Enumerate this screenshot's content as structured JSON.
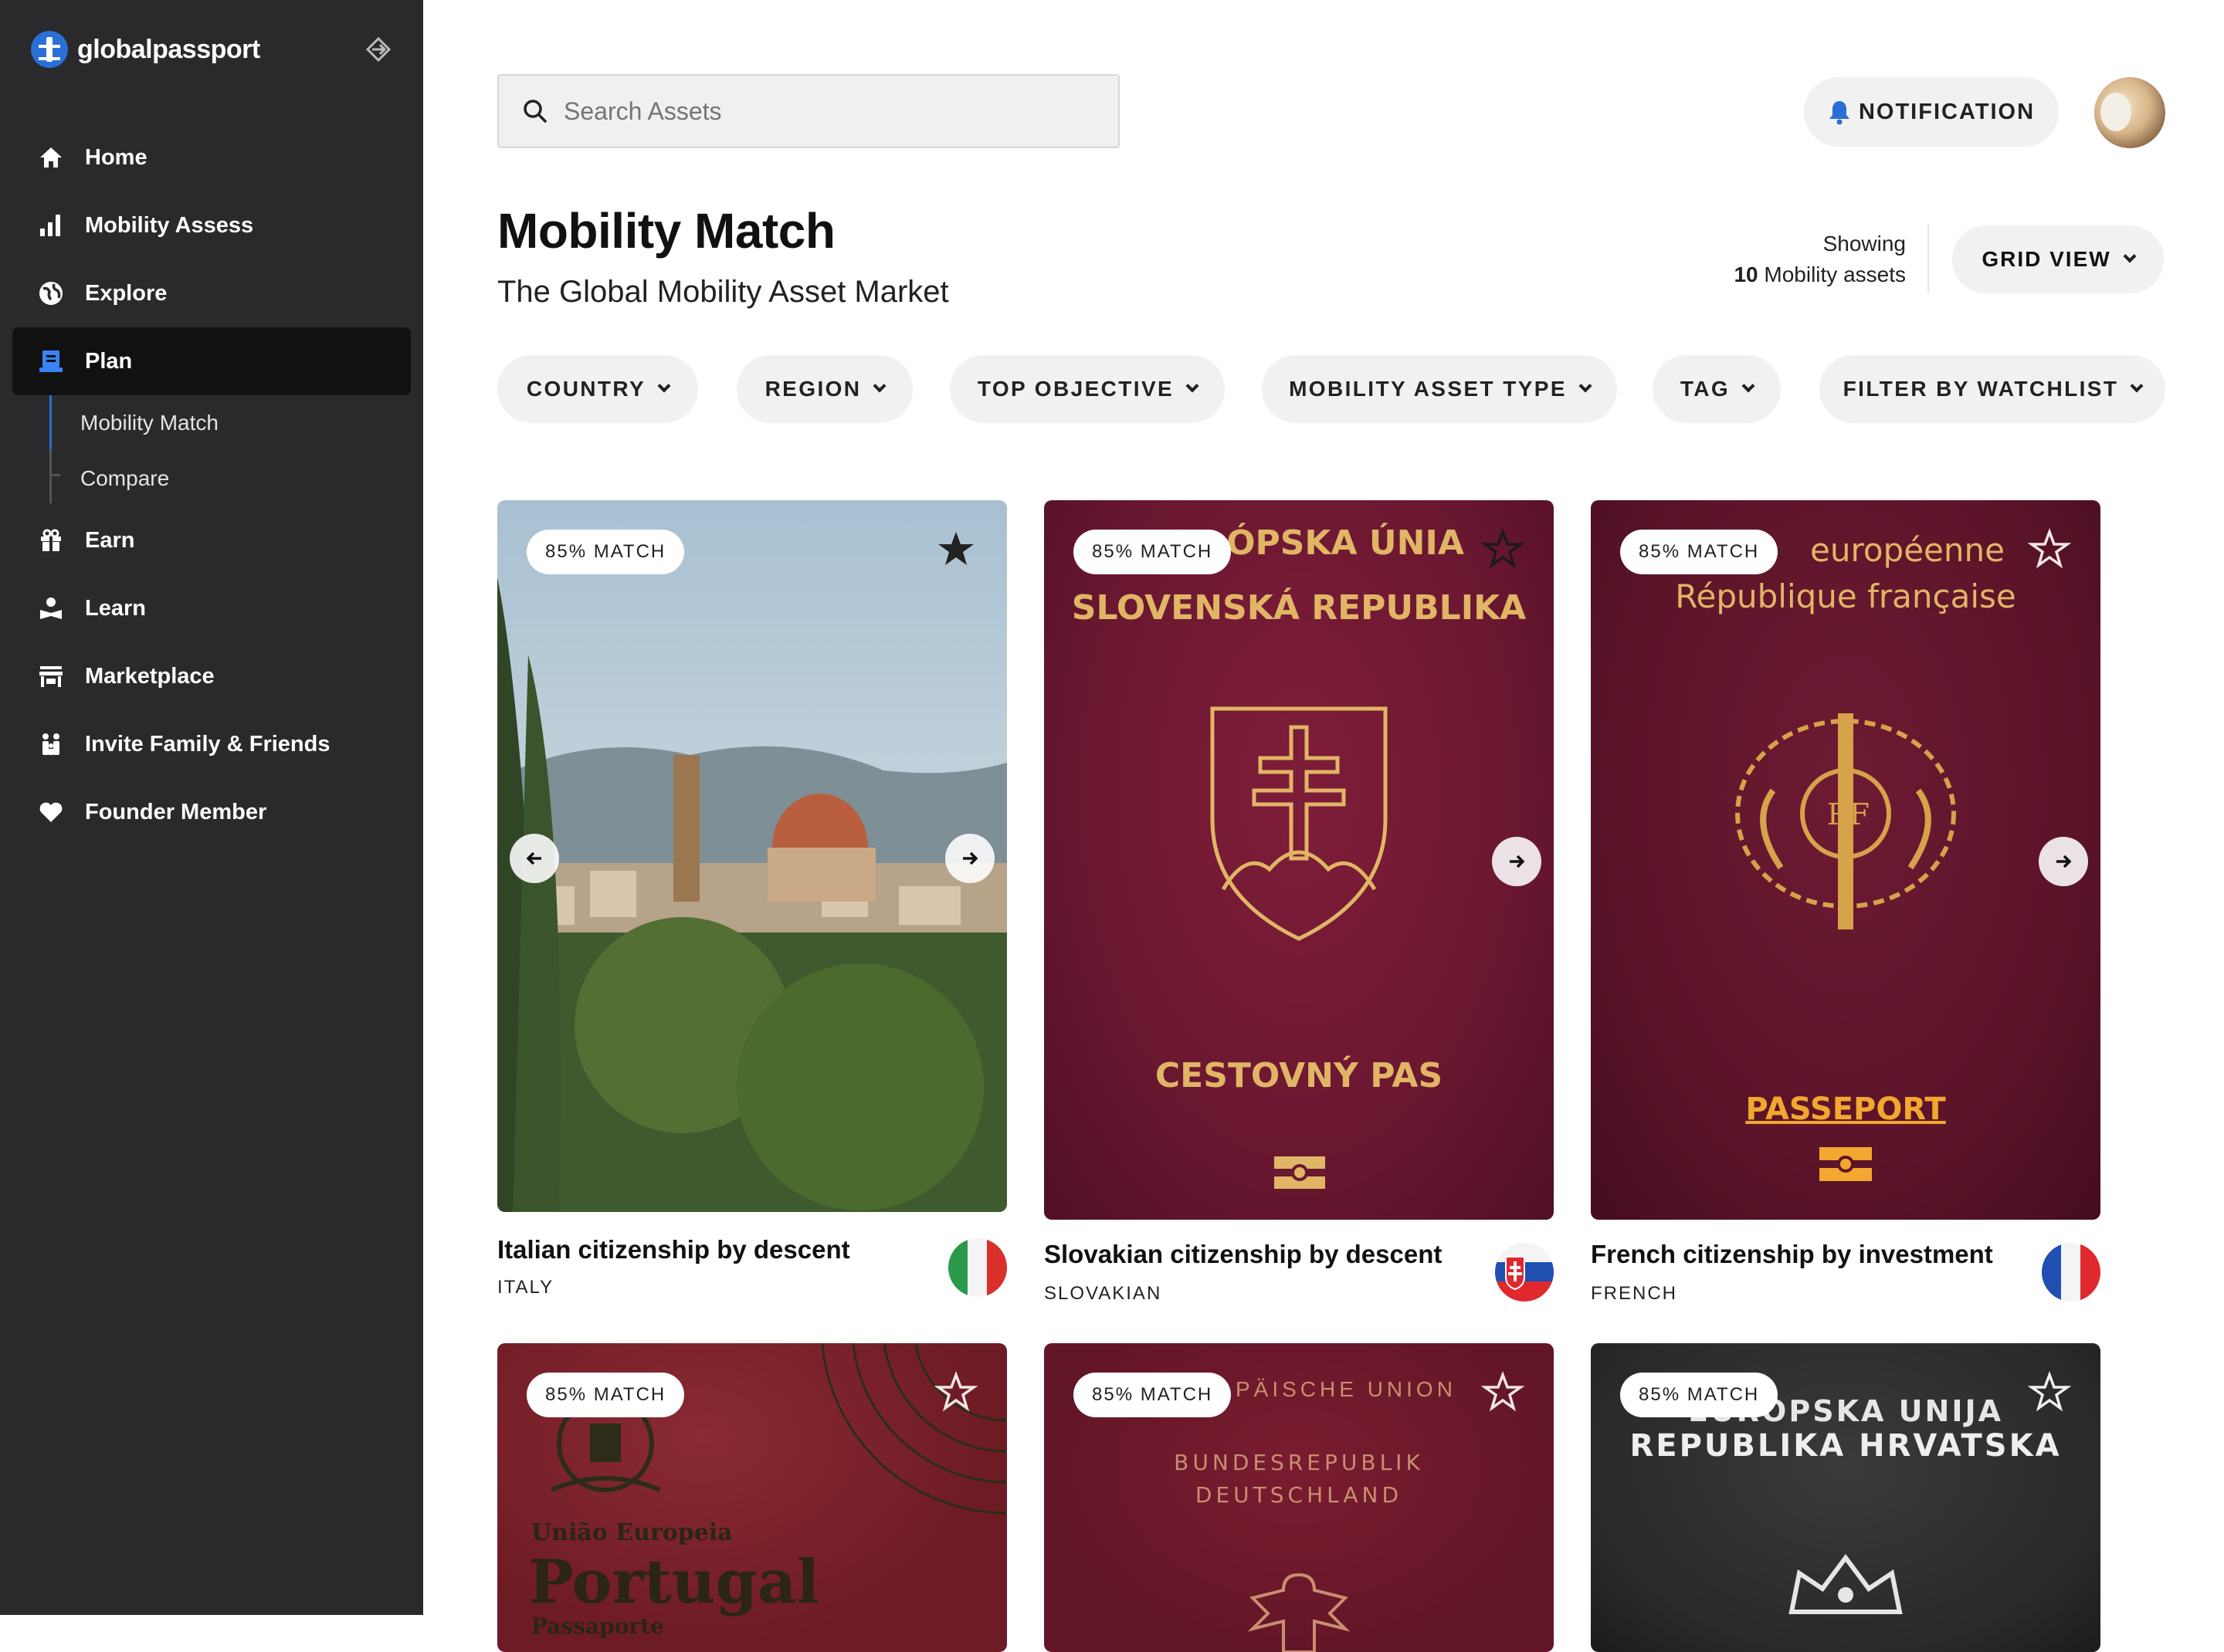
{
  "brand": {
    "name": "globalpassport"
  },
  "sidebar": {
    "items": [
      {
        "label": "Home",
        "icon": "home-icon"
      },
      {
        "label": "Mobility Assess",
        "icon": "bar-chart-icon"
      },
      {
        "label": "Explore",
        "icon": "globe-icon"
      },
      {
        "label": "Plan",
        "icon": "plan-icon",
        "active": true
      },
      {
        "label": "Earn",
        "icon": "gift-icon"
      },
      {
        "label": "Learn",
        "icon": "learn-icon"
      },
      {
        "label": "Marketplace",
        "icon": "store-icon"
      },
      {
        "label": "Invite Family & Friends",
        "icon": "family-icon"
      },
      {
        "label": "Founder Member",
        "icon": "heart-icon"
      }
    ],
    "subitems": [
      {
        "label": "Mobility Match",
        "active": true
      },
      {
        "label": "Compare"
      }
    ]
  },
  "header": {
    "search_placeholder": "Search Assets",
    "notification_label": "NOTIFICATION"
  },
  "page": {
    "title": "Mobility Match",
    "subtitle": "The Global Mobility Asset Market",
    "showing_label": "Showing",
    "showing_count": "10",
    "showing_suffix": "Mobility assets",
    "view_label": "GRID VIEW"
  },
  "filters": [
    {
      "label": "COUNTRY"
    },
    {
      "label": "REGION"
    },
    {
      "label": "TOP OBJECTIVE"
    },
    {
      "label": "MOBILITY ASSET TYPE"
    },
    {
      "label": "TAG"
    },
    {
      "label": "FILTER BY WATCHLIST"
    }
  ],
  "cards": [
    {
      "match": "85% MATCH",
      "title": "Italian citizenship by descent",
      "country": "ITALY"
    },
    {
      "match": "85% MATCH",
      "title": "Slovakian citizenship by descent",
      "country": "SLOVAKIAN",
      "cover": [
        "ÓPSKA ÚNIA",
        "SLOVENSKÁ REPUBLIKA",
        "CESTOVNÝ PAS"
      ]
    },
    {
      "match": "85% MATCH",
      "title": "French citizenship by investment",
      "country": "FRENCH",
      "cover": [
        "européenne",
        "République française",
        "PASSEPORT"
      ]
    },
    {
      "match": "85% MATCH",
      "cover": [
        "União Europeia",
        "Portugal",
        "Passaporte"
      ]
    },
    {
      "match": "85% MATCH",
      "cover": [
        "PÄISCHE UNION",
        "BUNDESREPUBLIK",
        "DEUTSCHLAND"
      ]
    },
    {
      "match": "85% MATCH",
      "cover": [
        "EUROPSKA UNIJA",
        "REPUBLIKA HRVATSKA"
      ]
    }
  ],
  "colors": {
    "sidebar_bg": "#2a2a2c",
    "active_bg": "#111112",
    "accent": "#2b6fd6",
    "chip_bg": "#f1f1f1"
  }
}
